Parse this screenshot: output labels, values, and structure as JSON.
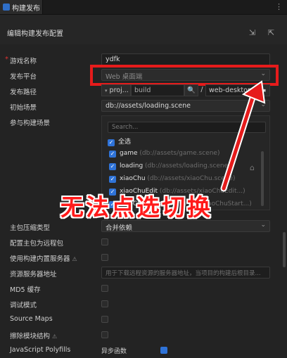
{
  "window": {
    "tab_title": "构建发布",
    "menu_label": "⋮"
  },
  "header": {
    "title": "编辑构建发布配置"
  },
  "rows": {
    "game_name": {
      "label": "游戏名称",
      "value": "ydfk"
    },
    "platform": {
      "label": "发布平台",
      "value": "Web 桌面端"
    },
    "build_path": {
      "label": "发布路径",
      "prefix": "proj...",
      "value": "build",
      "folder": "web-desktop"
    },
    "start_scene": {
      "label": "初始场景",
      "value": "db://assets/loading.scene"
    },
    "scenes": {
      "label": "参与构建场景",
      "search_placeholder": "Search...",
      "select_all": "全选",
      "items": [
        {
          "name": "game",
          "path": "(db://assets/game.scene)"
        },
        {
          "name": "loading",
          "path": "(db://assets/loading.scene)"
        },
        {
          "name": "xiaoChu",
          "path": "(db://assets/xiaoChu.scene)"
        },
        {
          "name": "xiaoChuEdit",
          "path": "(db://assets/xiaoChuEdit...)"
        },
        {
          "name": "xiaoChuStart",
          "path": "(db://assets/xiaoChuStart...)"
        }
      ]
    },
    "compress": {
      "label": "主包压缩类型",
      "value": "合并依赖"
    },
    "remote_main": {
      "label": "配置主包为远程包"
    },
    "builtin_server": {
      "label": "使用构建内置服务器"
    },
    "res_server": {
      "label": "资源服务器地址",
      "placeholder": "用于下载远程资源的服务器地址，当项目的构建后根目录..."
    },
    "md5": {
      "label": "MD5 缓存"
    },
    "debug": {
      "label": "调试模式"
    },
    "source_maps": {
      "label": "Source Maps"
    },
    "cull_modules": {
      "label": "擦除模块结构"
    },
    "polyfills": {
      "label": "JavaScript Polyfills",
      "value": "异步函数"
    }
  },
  "annotation": {
    "text": "无法点选切换"
  },
  "colors": {
    "accent": "#2f73d8",
    "highlight": "#e61b1b"
  }
}
